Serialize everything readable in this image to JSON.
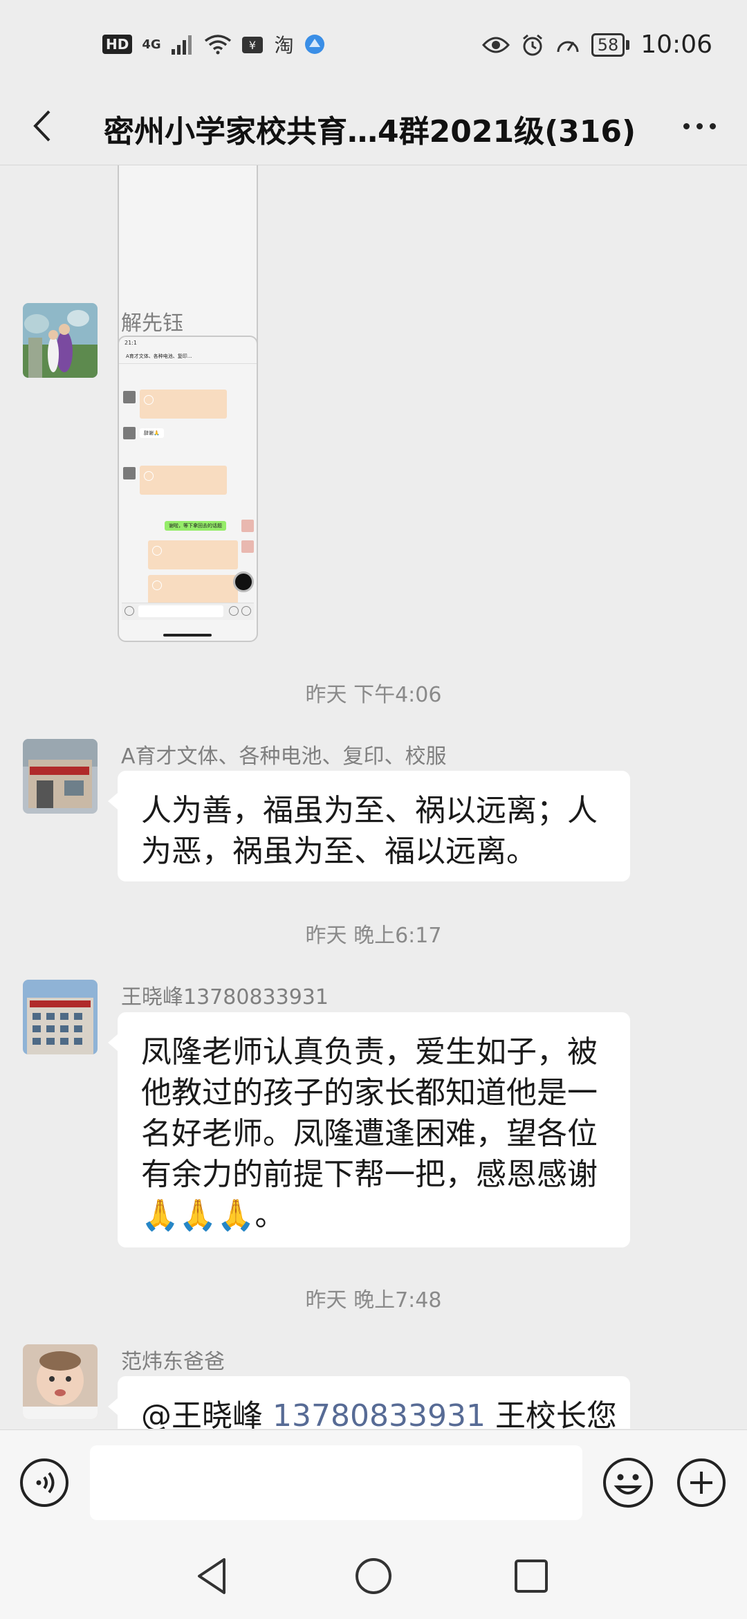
{
  "status_bar": {
    "hd": "HD",
    "network": "4G",
    "taobao": "淘",
    "battery": "58",
    "time": "10:06"
  },
  "header": {
    "title": "密州小学家校共育…4群2021级(316)",
    "back_icon": "chevron-left-icon",
    "more_icon": "more-dots-icon"
  },
  "messages": [
    {
      "type": "image",
      "sender": "",
      "content": "phone-screenshot (continued from above)"
    },
    {
      "type": "image",
      "sender": "解先钰",
      "shot": {
        "mini_time": "21:1",
        "mini_title": "A育才文体、各种电池、复印…",
        "mini_reply": "辞谢🙏",
        "mini_green": "谢啦，等下拿回去的话题"
      }
    },
    {
      "type": "time",
      "text": "昨天 下午4:06"
    },
    {
      "type": "text",
      "sender": "A育才文体、各种电池、复印、校服",
      "lines": [
        "人为善，福虽为至、祸以远离；人",
        "为恶，祸虽为至、福以远离。"
      ]
    },
    {
      "type": "time",
      "text": "昨天 晚上6:17"
    },
    {
      "type": "text",
      "sender": "王晓峰13780833931",
      "lines": [
        "凤隆老师认真负责，爱生如子，被",
        "他教过的孩子的家长都知道他是一",
        "名好老师。凤隆遭逢困难，望各位",
        "有余力的前提下帮一把，感恩感谢",
        "🙏🙏🙏。"
      ]
    },
    {
      "type": "time",
      "text": "昨天 晚上7:48"
    },
    {
      "type": "text",
      "sender": "范炜东爸爸",
      "mention": "@王晓峰",
      "mention_number": "13780833931",
      "rest": "王校长您"
    }
  ],
  "input_bar": {
    "placeholder": "",
    "voice_icon": "voice-icon",
    "emoji_icon": "emoji-icon",
    "plus_icon": "plus-circle-icon"
  },
  "nav_bar": {
    "back_icon": "nav-back-icon",
    "home_icon": "nav-home-icon",
    "recents_icon": "nav-recents-icon"
  },
  "colors": {
    "background": "#ededed",
    "bubble": "#ffffff",
    "mention": "#576b95",
    "timestamp": "#8a8a8a"
  }
}
